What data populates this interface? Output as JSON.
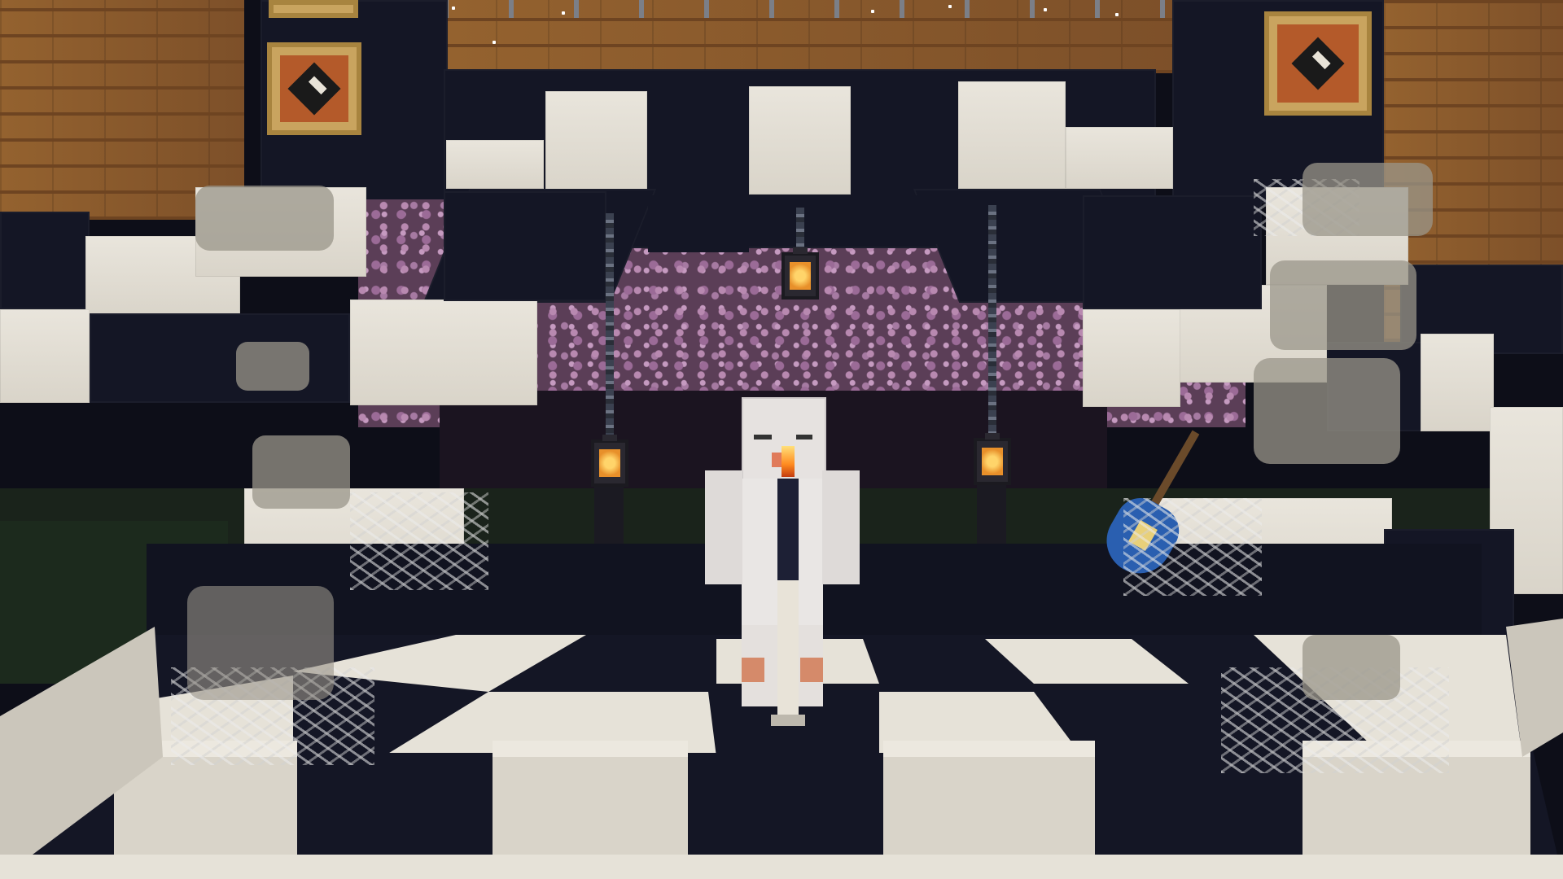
{
  "scene": {
    "palette": {
      "sky": "#0e0f1a",
      "black_wool": "#141625",
      "white_wool": "#e6e2d8",
      "wood": "#8a5a2f",
      "blossom": "#5b3e57",
      "lantern_glow": "#ffd46a",
      "guitar": "#2a5fb0"
    },
    "objects": [
      {
        "name": "item-frame",
        "count": 3
      },
      {
        "name": "hanging-lantern",
        "count": 3
      },
      {
        "name": "candle",
        "count": 1
      },
      {
        "name": "guitar",
        "count": 1
      },
      {
        "name": "cobweb",
        "count": 5
      }
    ]
  }
}
